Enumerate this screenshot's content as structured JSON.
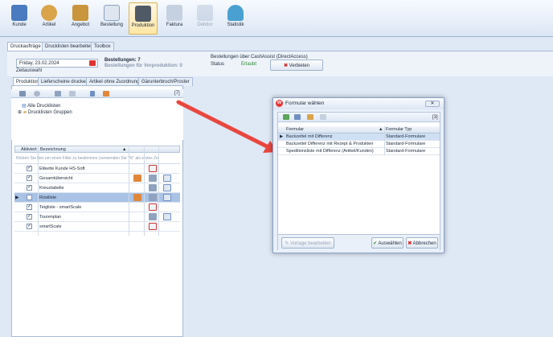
{
  "ribbon": {
    "items": [
      {
        "label": "Kunde",
        "color": "#4a7bc0"
      },
      {
        "label": "Artikel",
        "color": "#d9a44a"
      },
      {
        "label": "Angebot",
        "color": "#c9953d"
      },
      {
        "label": "Bestellung",
        "color": "#8aa0bd"
      },
      {
        "label": "Produktion",
        "color": "#505a66"
      },
      {
        "label": "Faktura",
        "color": "#9fb0c8"
      },
      {
        "label": "Debitor",
        "color": "#9fb0c8"
      },
      {
        "label": "Statistik",
        "color": "#4aa0d0"
      }
    ]
  },
  "tabs_main": [
    "Druckaufträge",
    "Drucklisten bearbeiten",
    "Toolbox"
  ],
  "top_panel": {
    "date": "Friday, 23.02.2024",
    "zeitauswahl": "Zeitauswahl",
    "bestellungen_label": "Bestellungen: 7",
    "bestellungen_vorproduktion": "Bestellungen für Vorproduktion: 0",
    "cashassist_title": "Bestellungen über CashAssist (DirectAccess)",
    "status_label": "Status",
    "status_value": "Erlaubt",
    "verbieten_label": "Verbieten"
  },
  "tabs_sub": [
    "Produktion",
    "Lieferscheine drucken",
    "Artikel ohne Zuordnung",
    "Gärunterbruch/Proster"
  ],
  "tree": {
    "items": [
      "Alle Drucklisten",
      "Drucklisten Gruppen"
    ],
    "count_badge": "[7]"
  },
  "grid": {
    "col_aktiviert": "Aktiviert",
    "col_bezeichnung": "Bezeichnung",
    "filter_hint": "Klicken Sie hier um einen Filter zu bestimmen (verwenden Sie \"%\" als erstes Ze",
    "rows": [
      {
        "name": "Etikette Kunde HS-Soft",
        "checked": "✓"
      },
      {
        "name": "Gesamtübersicht",
        "checked": "✓"
      },
      {
        "name": "Kreuztabelle",
        "checked": "✓"
      },
      {
        "name": "Rüstliste",
        "checked": ""
      },
      {
        "name": "Teigliste - smartScale",
        "checked": "✓"
      },
      {
        "name": "Tourenplan",
        "checked": "✓"
      },
      {
        "name": "smartScale",
        "checked": "✓"
      }
    ]
  },
  "dialog": {
    "title": "Formular wählen",
    "count_badge": "[3]",
    "col_formular": "Formular",
    "col_typ": "Formular Typ",
    "rows": [
      {
        "formular": "Backzettel mit Differenz",
        "typ": "Standard-Formulare"
      },
      {
        "formular": "Backzettel Differenz mit Rezept & Produkten",
        "typ": "Standard-Formulare"
      },
      {
        "formular": "Speditionsliste mit Differenz (Artikel/Kunden)",
        "typ": "Standard-Formulare"
      }
    ],
    "btn_vorlage": "Vorlage bearbeiten",
    "btn_auswaehlen": "Auswählen",
    "btn_abbrechen": "Abbrechen"
  },
  "colors": {
    "arrow": "#e8473f",
    "accent": "#a9c3e6"
  }
}
